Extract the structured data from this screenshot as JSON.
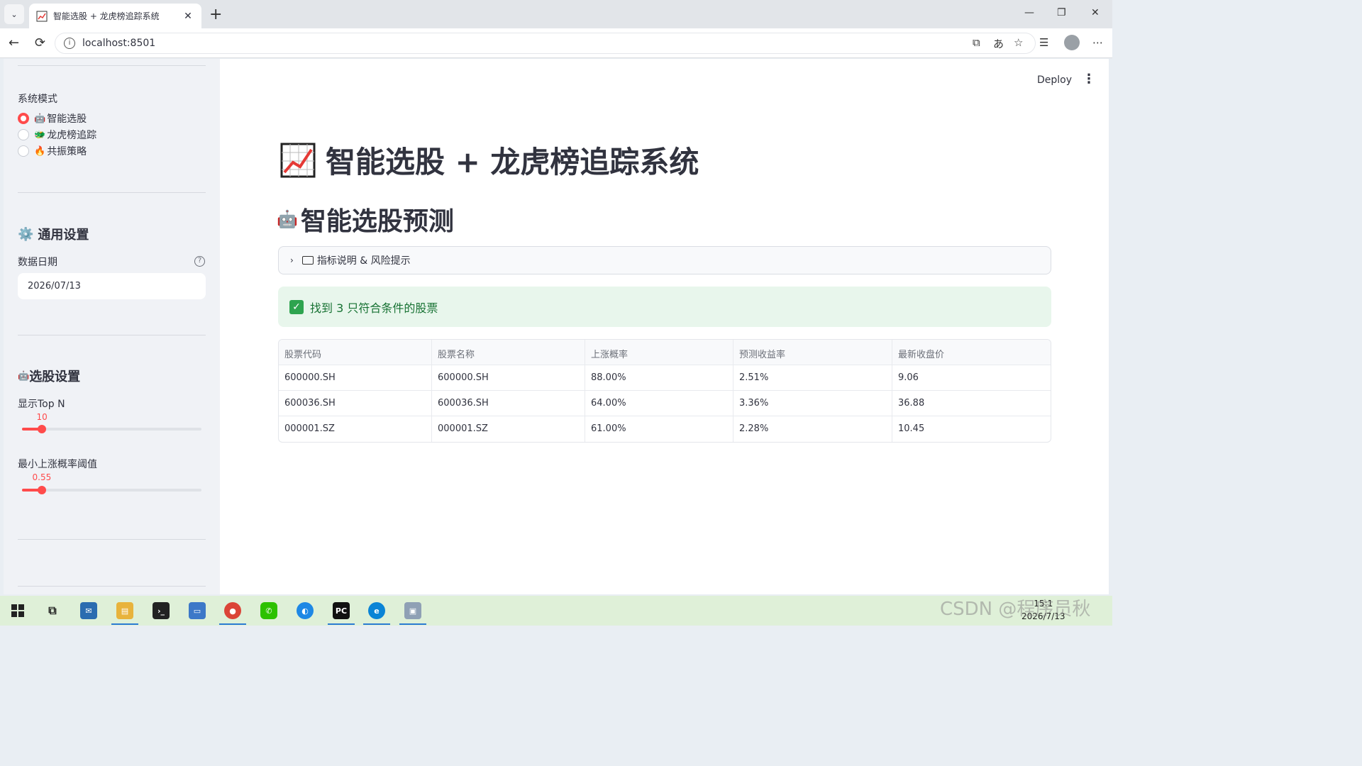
{
  "browser": {
    "tab_title": "智能选股 + 龙虎榜追踪系统",
    "tab_close": "✕",
    "new_tab": "+",
    "url": "localhost:8501",
    "min": "—",
    "max": "❐",
    "close": "✕",
    "back": "←",
    "reload": "⟳",
    "more": "⋯"
  },
  "sidebar": {
    "mode_label": "系统模式",
    "modes": [
      {
        "emoji": "🤖",
        "label": "智能选股",
        "selected": true
      },
      {
        "emoji": "🐲",
        "label": "龙虎榜追踪",
        "selected": false
      },
      {
        "emoji": "🔥",
        "label": "共振策略",
        "selected": false
      }
    ],
    "general_heading": "通用设置",
    "general_icon": "⚙️",
    "date_label": "数据日期",
    "help_glyph": "?",
    "date_value": "2026/07/13",
    "stock_heading": "选股设置",
    "stock_icon": "🤖",
    "topn_label": "显示Top N",
    "topn_value": "10",
    "topn_fraction": 0.11,
    "prob_label": "最小上涨概率阈值",
    "prob_value": "0.55",
    "prob_fraction": 0.11
  },
  "main": {
    "deploy": "Deploy",
    "menu": "⋮",
    "title": "智能选股 + 龙虎榜追踪系统",
    "section_title": "智能选股预测",
    "section_icon": "🤖",
    "expander_label": "指标说明 & 风险提示",
    "expander_chevron": "›",
    "success_msg": "找到 3 只符合条件的股票",
    "success_check": "✓",
    "table": {
      "headers": [
        "股票代码",
        "股票名称",
        "上涨概率",
        "预测收益率",
        "最新收盘价"
      ],
      "rows": [
        [
          "600000.SH",
          "600000.SH",
          "88.00%",
          "2.51%",
          "9.06"
        ],
        [
          "600036.SH",
          "600036.SH",
          "64.00%",
          "3.36%",
          "36.88"
        ],
        [
          "000001.SZ",
          "000001.SZ",
          "61.00%",
          "2.28%",
          "10.45"
        ]
      ]
    }
  },
  "taskbar": {
    "time": "15:1",
    "date": "2026/7/13"
  },
  "watermark": "CSDN @程序员秋",
  "colors": {
    "accent": "#ff4b4b",
    "success_bg": "#e8f6ec",
    "success_text": "#177233",
    "sidebar_bg": "#f0f2f6"
  }
}
